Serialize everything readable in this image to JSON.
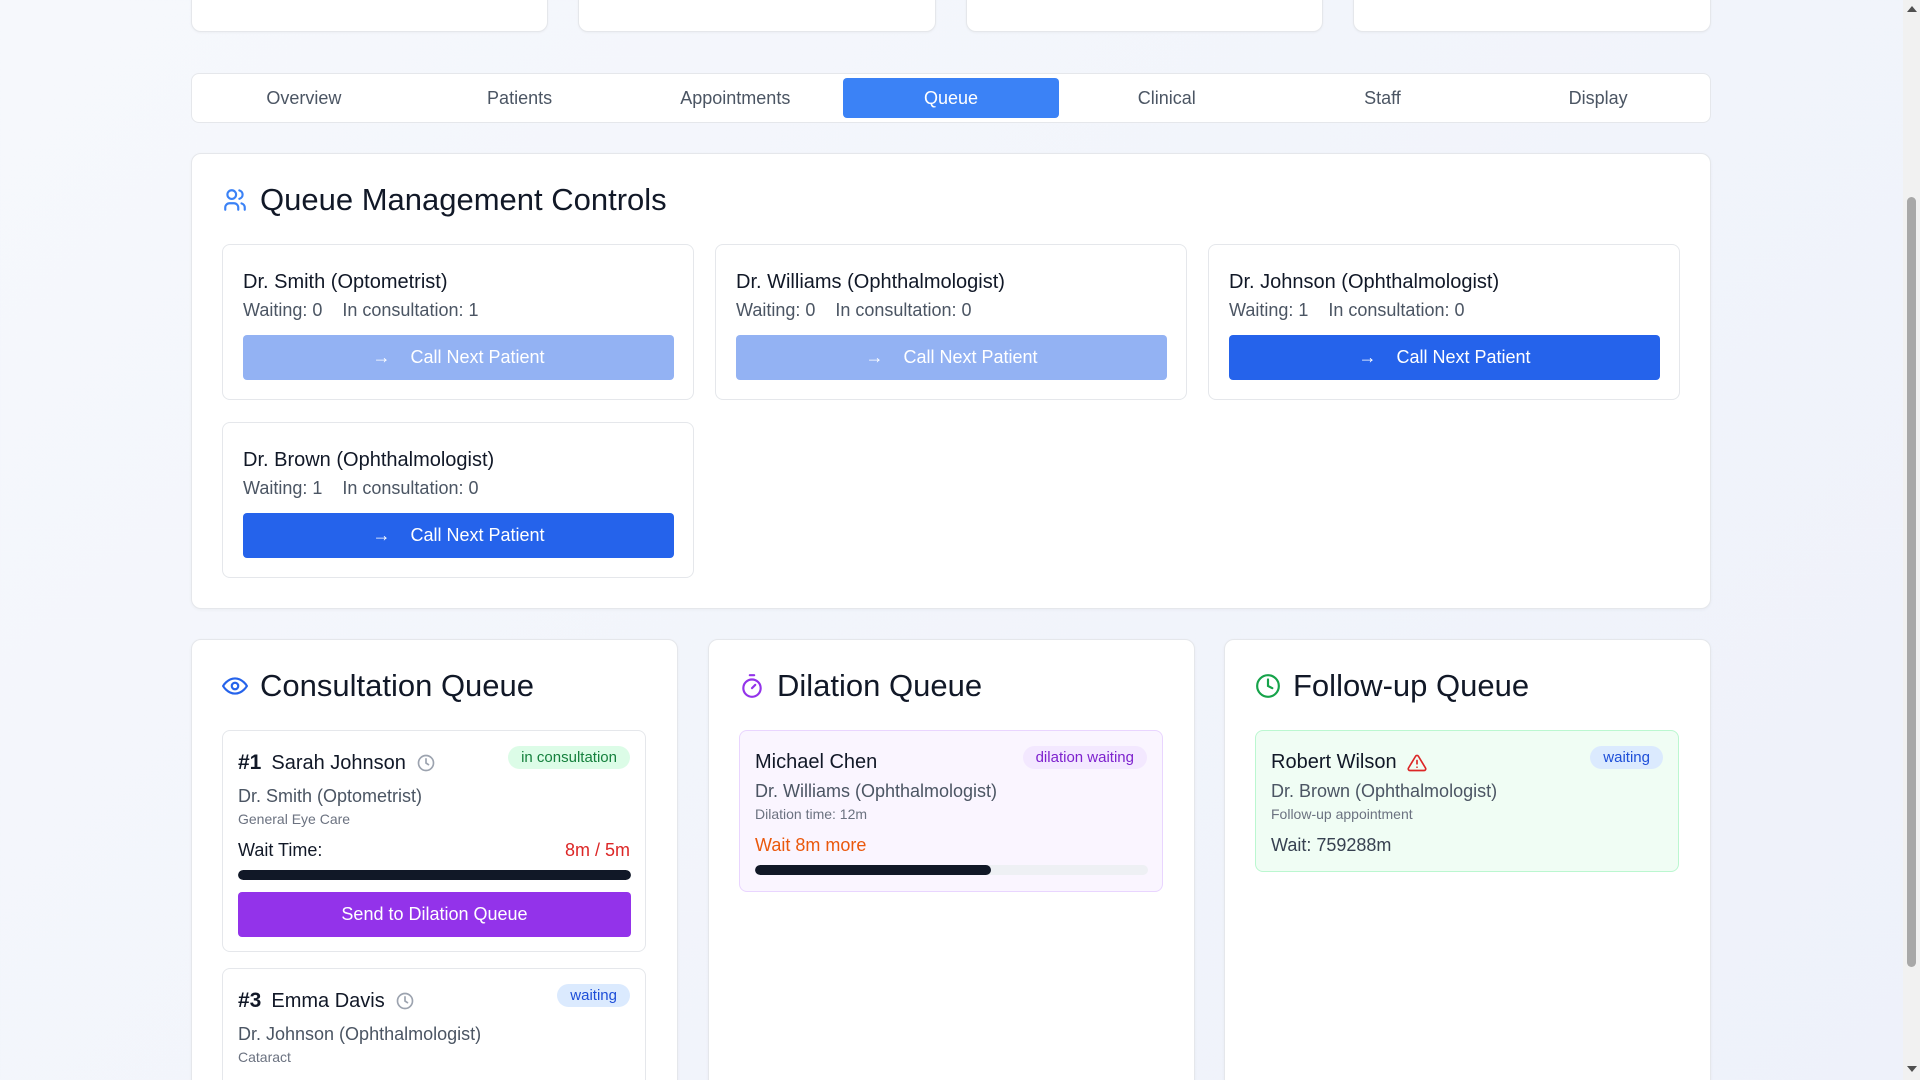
{
  "tabs": [
    "Overview",
    "Patients",
    "Appointments",
    "Queue",
    "Clinical",
    "Staff",
    "Display"
  ],
  "active_tab": "Queue",
  "controls": {
    "title": "Queue Management Controls",
    "waiting_label": "Waiting:",
    "consult_label": "In consultation:",
    "button_label": "Call Next Patient",
    "doctors": [
      {
        "name": "Dr. Smith (Optometrist)",
        "waiting": "0",
        "consult": "1",
        "disabled": true
      },
      {
        "name": "Dr. Williams (Ophthalmologist)",
        "waiting": "0",
        "consult": "0",
        "disabled": true
      },
      {
        "name": "Dr. Johnson (Ophthalmologist)",
        "waiting": "1",
        "consult": "0",
        "disabled": false
      },
      {
        "name": "Dr. Brown (Ophthalmologist)",
        "waiting": "1",
        "consult": "0",
        "disabled": false
      }
    ]
  },
  "consultation": {
    "title": "Consultation Queue",
    "items": [
      {
        "num": "#1",
        "name": "Sarah Johnson",
        "badge": "in consultation",
        "doctor": "Dr. Smith (Optometrist)",
        "type": "General Eye Care",
        "wait_label": "Wait Time:",
        "wait_value": "8m / 5m",
        "progress": 1.0,
        "action": "Send to Dilation Queue"
      },
      {
        "num": "#3",
        "name": "Emma Davis",
        "badge": "waiting",
        "doctor": "Dr. Johnson (Ophthalmologist)",
        "type": "Cataract"
      }
    ]
  },
  "dilation": {
    "title": "Dilation Queue",
    "item": {
      "name": "Michael Chen",
      "badge": "dilation waiting",
      "doctor": "Dr. Williams (Ophthalmologist)",
      "time": "Dilation time: 12m",
      "wait": "Wait 8m more",
      "progress": 0.6
    }
  },
  "followup": {
    "title": "Follow-up Queue",
    "item": {
      "name": "Robert Wilson",
      "badge": "waiting",
      "doctor": "Dr. Brown (Ophthalmologist)",
      "type": "Follow-up appointment",
      "wait": "Wait: 759288m"
    }
  },
  "colors": {
    "primary": "#2563eb",
    "tab_active": "#3b82f6",
    "purple": "#9333ea",
    "orange": "#ea580c",
    "red": "#dc2626",
    "green": "#16a34a"
  }
}
